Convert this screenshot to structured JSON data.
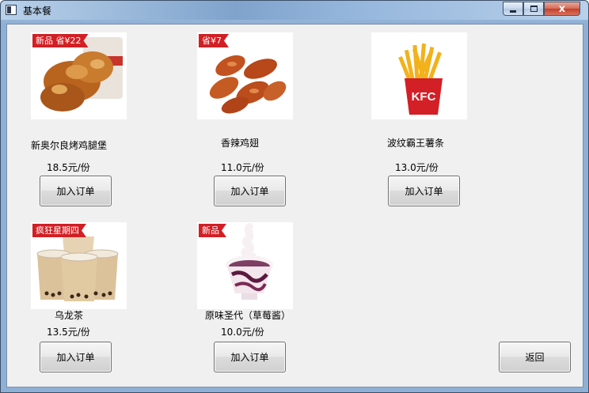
{
  "window": {
    "title": "基本餐",
    "min_label": "",
    "max_label": "",
    "close_label": "x"
  },
  "products": [
    {
      "name": "新奥尔良烤鸡腿堡",
      "price": "18.5元/份",
      "promo": "新品 省¥22",
      "button": "加入订单",
      "image": "fried-chicken-bucket-image"
    },
    {
      "name": "香辣鸡翅",
      "price": "11.0元/份",
      "promo": "省¥7",
      "button": "加入订单",
      "image": "chicken-wings-image"
    },
    {
      "name": "波纹霸王薯条",
      "price": "13.0元/份",
      "promo": "",
      "button": "加入订单",
      "image": "fries-image"
    },
    {
      "name": "乌龙茶",
      "price": "13.5元/份",
      "promo": "疯狂星期四",
      "button": "加入订单",
      "image": "milk-tea-image"
    },
    {
      "name": "原味圣代（草莓酱）",
      "price": "10.0元/份",
      "promo": "新品",
      "button": "加入订单",
      "image": "sundae-image"
    }
  ],
  "back_button": "返回",
  "colors": {
    "promo": "#d21f24",
    "client_bg": "#f0f0f0"
  }
}
